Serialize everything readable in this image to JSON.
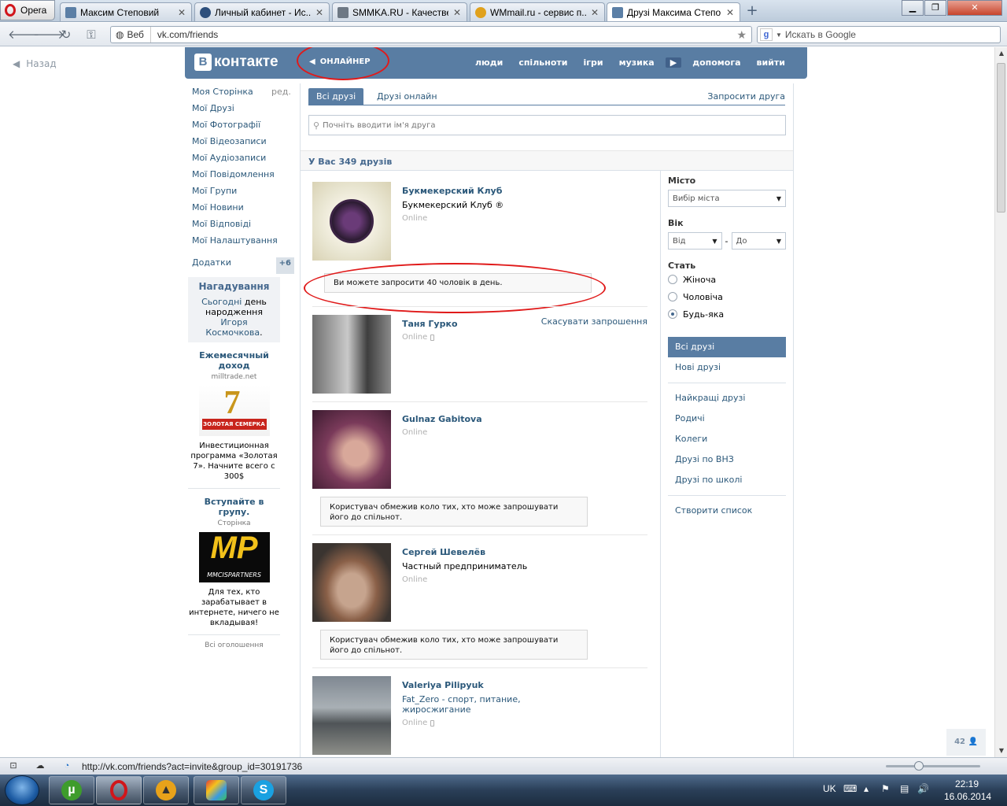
{
  "browser": {
    "menu_label": "Opera",
    "tabs": [
      {
        "label": "Максим Степовий",
        "favicon_color": "#5b7fa6"
      },
      {
        "label": "Личный кабинет - Ис...",
        "favicon_color": "#2d4f7c"
      },
      {
        "label": "SMMKA.RU - Качестве...",
        "favicon_color": "#6d7884"
      },
      {
        "label": "WMmail.ru - сервис п...",
        "favicon_color": "#e0a11c"
      },
      {
        "label": "Друзі Максима Степо...",
        "favicon_color": "#5b7fa6"
      }
    ],
    "web_label": "Веб",
    "url": "vk.com/friends",
    "search_placeholder": "Искать в Google",
    "status_url": "http://vk.com/friends?act=invite&group_id=30191736"
  },
  "vk": {
    "back_label": "Назад",
    "logo_text": "контакте",
    "logo_letter": "В",
    "online_label": "ОНЛАЙНЕР",
    "nav": [
      "люди",
      "спільноти",
      "ігри",
      "музика",
      "допомога",
      "вийти"
    ],
    "left_menu": [
      "Моя Сторінка",
      "Мої Друзі",
      "Мої Фотографії",
      "Мої Відеозаписи",
      "Мої Аудіозаписи",
      "Мої Повідомлення",
      "Мої Групи",
      "Мої Новини",
      "Мої Відповіді",
      "Мої Налаштування"
    ],
    "edit_label": "ред.",
    "apps_label": "Додатки",
    "apps_badge": "+6",
    "reminder": {
      "title": "Нагадування",
      "today": "Сьогодні",
      "text1": "день народження",
      "name": "Игоря Космочкова",
      "dot": "."
    },
    "ads": [
      {
        "title": "Ежемесячный доход",
        "domain": "milltrade.net",
        "body": "Инвестиционная программа «Золотая 7». Начните всего с 300$",
        "image_caption": "ЗОЛОТАЯ СЕМЕРКА",
        "image_big": "7"
      },
      {
        "title": "Вступайте в групу.",
        "domain": "Сторінка",
        "body": "Для тех, кто зарабатывает в интернете, ничего не вкладывая!",
        "image_caption": "MMCISPARTNERS",
        "image_big": "MP"
      }
    ],
    "all_ads": "Всі оголошення",
    "tabs": {
      "all": "Всі друзі",
      "online": "Друзі онлайн",
      "request": "Запросити друга"
    },
    "search_placeholder": "Почніть вводити ім'я друга",
    "friends_count": "У Вас 349 друзів",
    "limit_notice": "Ви можете запросити 40 чоловік в день.",
    "restricted_notice": "Користувач обмежив коло тих, хто може запрошувати його до спільнот.",
    "friends": [
      {
        "name": "Букмекерский Клуб",
        "sub": "Букмекерский Клуб ®",
        "status": "Online",
        "mobile": false
      },
      {
        "name": "Таня Гурко",
        "sub": "",
        "status": "Online",
        "mobile": true,
        "action": "Скасувати запрошення"
      },
      {
        "name": "Gulnaz Gabitova",
        "sub": "",
        "status": "Online",
        "mobile": false
      },
      {
        "name": "Сергей Шевелёв",
        "sub": "Частный предприниматель",
        "status": "Online",
        "mobile": false
      },
      {
        "name": "Valeriya Pilipyuk",
        "sub": "Fat_Zero - спорт, питание, жиросжигание",
        "status": "Online",
        "mobile": true
      }
    ],
    "filters": {
      "city_title": "Місто",
      "city_placeholder": "Вибір міста",
      "age_title": "Вік",
      "age_from": "Від",
      "age_dash": "-",
      "age_to": "До",
      "gender_title": "Стать",
      "genders": [
        "Жіноча",
        "Чоловіча",
        "Будь-яка"
      ],
      "selected_gender": "Будь-яка",
      "menu1": [
        "Всі друзі",
        "Нові друзі"
      ],
      "menu2": [
        "Найкращі друзі",
        "Родичі",
        "Колеги",
        "Друзі по ВНЗ",
        "Друзі по школі"
      ],
      "create_list": "Створити список"
    },
    "corner_count": "42"
  },
  "taskbar": {
    "lang": "UK",
    "time": "22:19",
    "date": "16.06.2014"
  },
  "colors": {
    "vk_blue": "#597da3",
    "link": "#2b587a",
    "annotation_red": "#e01a1a"
  }
}
